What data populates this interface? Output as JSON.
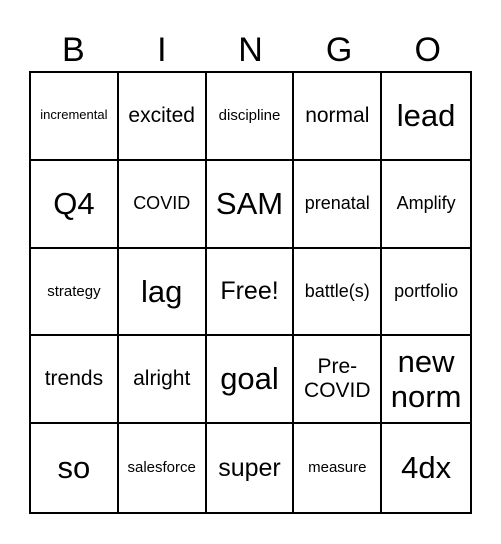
{
  "header": {
    "letters": [
      "B",
      "I",
      "N",
      "G",
      "O"
    ]
  },
  "card": {
    "rows": [
      [
        "incremental",
        "excited",
        "discipline",
        "normal",
        "lead"
      ],
      [
        "Q4",
        "COVID",
        "SAM",
        "prenatal",
        "Amplify"
      ],
      [
        "strategy",
        "lag",
        "Free!",
        "battle(s)",
        "portfolio"
      ],
      [
        "trends",
        "alright",
        "goal",
        "Pre-\nCOVID",
        "new\nnorm"
      ],
      [
        "so",
        "salesforce",
        "super",
        "measure",
        "4dx"
      ]
    ],
    "free_space": "Free!"
  }
}
